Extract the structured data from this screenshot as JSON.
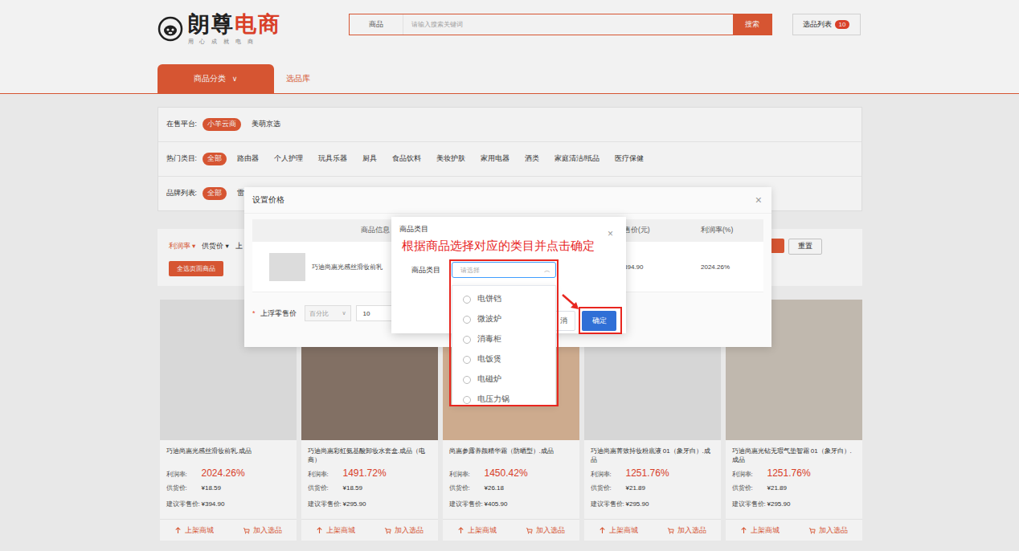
{
  "header": {
    "logo": {
      "name_a": "朗尊",
      "name_b": "电商",
      "slogan": "用 心 成 就 电 商"
    },
    "search": {
      "category": "商品",
      "placeholder": "请输入搜索关键词",
      "button": "搜索"
    },
    "selection_list": {
      "label": "选品列表",
      "badge": "10"
    }
  },
  "nav": {
    "tabs": [
      {
        "label": "商品分类",
        "icon": "∨",
        "selected": true
      },
      {
        "label": "选品库",
        "icon": "",
        "selected": false
      }
    ]
  },
  "filters": [
    {
      "label": "在售平台:",
      "options": [
        {
          "label": "小羊云商",
          "selected": true
        },
        {
          "label": "美萌京选",
          "selected": false
        }
      ]
    },
    {
      "label": "热门类目:",
      "options": [
        {
          "label": "全部",
          "selected": true
        },
        {
          "label": "路由器",
          "selected": false
        },
        {
          "label": "个人护理",
          "selected": false
        },
        {
          "label": "玩具乐器",
          "selected": false
        },
        {
          "label": "厨具",
          "selected": false
        },
        {
          "label": "食品饮料",
          "selected": false
        },
        {
          "label": "美妆护肤",
          "selected": false
        },
        {
          "label": "家用电器",
          "selected": false
        },
        {
          "label": "酒类",
          "selected": false
        },
        {
          "label": "家庭清洁/纸品",
          "selected": false
        },
        {
          "label": "医疗保健",
          "selected": false
        }
      ]
    },
    {
      "label": "品牌列表:",
      "options": [
        {
          "label": "全部",
          "selected": true
        },
        {
          "label": "雷",
          "selected": false
        }
      ]
    }
  ],
  "sort": {
    "items": [
      {
        "label": "利润率",
        "arrow": "▾",
        "selected": true
      },
      {
        "label": "供货价",
        "arrow": "▾",
        "selected": false
      },
      {
        "label": "上",
        "arrow": "",
        "selected": false
      }
    ],
    "select_all": "全选页面商品",
    "reset": "重置"
  },
  "products": {
    "labels": {
      "profit": "利润率:",
      "supply": "供货价:",
      "retail": "建议零售价:"
    },
    "actions": {
      "list": "上架商城",
      "add": "加入选品"
    },
    "items": [
      {
        "name": "巧迪尚惠光感丝滑妆前乳.成品",
        "profit": "2024.26%",
        "supply": "¥18.59",
        "retail": "¥394.90",
        "color": "#e4e4e4"
      },
      {
        "name": "巧迪尚惠彩虹氨基酸卸妆水套盒.成品（电商）",
        "profit": "1491.72%",
        "supply": "¥18.59",
        "retail": "¥295.90",
        "color": "#8a776a"
      },
      {
        "name": "尚惠参露养颜精华霜（防晒型）.成品",
        "profit": "1450.42%",
        "supply": "¥26.18",
        "retail": "¥405.90",
        "color": "#d8b596"
      },
      {
        "name": "巧迪尚惠菁致持妆粉底液 01（象牙白）.成品",
        "profit": "1251.76%",
        "supply": "¥21.89",
        "retail": "¥295.90",
        "color": "#e2e2e2"
      },
      {
        "name": "巧迪尚惠光钻无瑕气垫智霜 01（象牙白）.成品",
        "profit": "1251.76%",
        "supply": "¥21.89",
        "retail": "¥295.90",
        "color": "#cbc2b8"
      }
    ]
  },
  "price_dialog": {
    "title": "设置价格",
    "close": "×",
    "columns": [
      "商品信息",
      "售价(元)",
      "利润率(%)"
    ],
    "row": {
      "name": "巧迪尚惠光感丝滑妆前乳",
      "retail": "394.90",
      "profit": "2024.26%"
    },
    "markup": {
      "required": "*",
      "label": "上浮零售价",
      "mode": "百分比",
      "mode_icon": "∨",
      "value": "10"
    }
  },
  "category_dialog": {
    "title": "商品类目",
    "close": "×",
    "label": "商品类目",
    "select": {
      "placeholder": "请选择",
      "icon": "︿",
      "expanded": true
    },
    "options": [
      {
        "label": "电饼铛",
        "selected": false
      },
      {
        "label": "微波炉",
        "selected": false
      },
      {
        "label": "消毒柜",
        "selected": false
      },
      {
        "label": "电饭煲",
        "selected": false
      },
      {
        "label": "电磁炉",
        "selected": false
      },
      {
        "label": "电压力锅",
        "selected": false
      }
    ],
    "buttons": [
      {
        "label": "消",
        "kind": "cancel"
      },
      {
        "label": "确定",
        "kind": "confirm"
      }
    ]
  },
  "annotation": {
    "text": "根据商品选择对应的类目并点击确定"
  }
}
